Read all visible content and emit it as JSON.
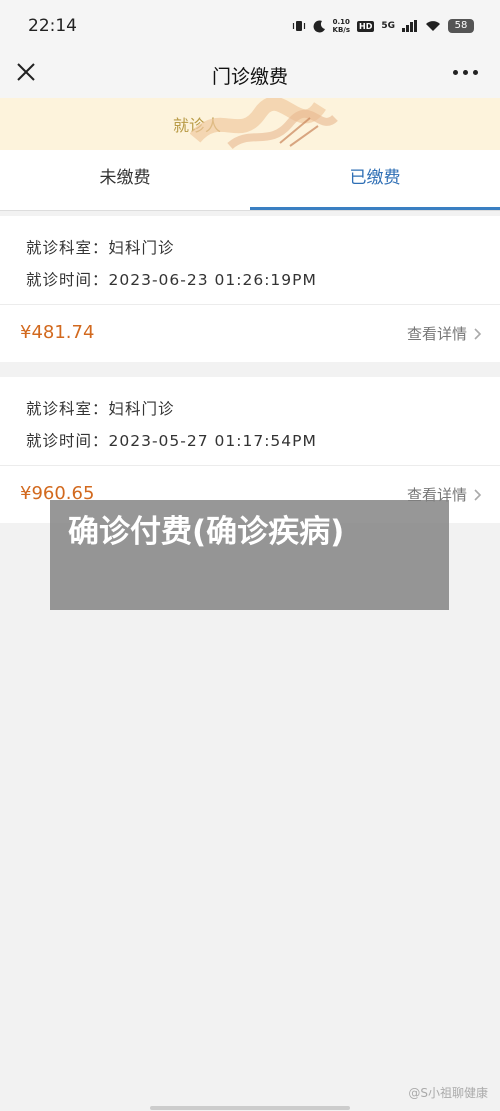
{
  "status_bar": {
    "time": "22:14",
    "net_speed_value": "0.10",
    "net_speed_unit": "KB/s",
    "hd_label": "HD",
    "signal_label": "5G",
    "battery": "58"
  },
  "header": {
    "title": "门诊缴费"
  },
  "patient": {
    "label": "就诊人"
  },
  "tabs": [
    {
      "label": "未缴费"
    },
    {
      "label": "已缴费"
    }
  ],
  "records": [
    {
      "dept_label": "就诊科室：",
      "dept_value": "妇科门诊",
      "time_label": "就诊时间：",
      "time_value": "2023-06-23 01:26:19PM",
      "amount": "¥481.74",
      "detail_label": "查看详情"
    },
    {
      "dept_label": "就诊科室：",
      "dept_value": "妇科门诊",
      "time_label": "就诊时间：",
      "time_value": "2023-05-27 01:17:54PM",
      "amount": "¥960.65",
      "detail_label": "查看详情"
    }
  ],
  "overlay_caption": "确诊付费(确诊疾病)",
  "watermark": "@S小祖聊健康",
  "colors": {
    "accent": "#2f6fb5",
    "price": "#d2691e",
    "patient_bar": "#fdf3dc"
  }
}
